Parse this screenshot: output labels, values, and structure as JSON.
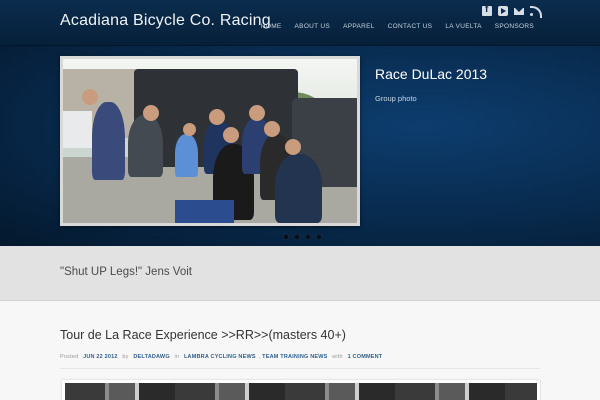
{
  "site": {
    "title": "Acadiana Bicycle Co. Racing"
  },
  "social": {
    "icons": [
      "facebook-icon",
      "youtube-icon",
      "mail-icon",
      "rss-icon"
    ]
  },
  "nav": {
    "items": [
      "HOME",
      "ABOUT US",
      "APPAREL",
      "CONTACT US",
      "LA VUELTA",
      "SPONSORS"
    ]
  },
  "slider": {
    "title": "Race DuLac 2013",
    "caption": "Group photo",
    "dots": 4,
    "active_dot": 1
  },
  "quote": {
    "text": "\"Shut UP Legs!\" Jens Voit"
  },
  "post": {
    "title": "Tour de La Race Experience >>RR>>(masters 40+)",
    "posted_label": "Posted",
    "date": "JUN 22 2012",
    "by_label": "by",
    "author": "DELTADAWG",
    "in_label": "in",
    "category_1": "LAMBRA CYCLING NEWS",
    "category_2": "TEAM TRAINING NEWS",
    "with_label": "with",
    "comments": "1 COMMENT"
  },
  "colors": {
    "header_bg": "#0b2c4d",
    "hero_bg": "#082a4d",
    "link": "#2f5f8c"
  }
}
